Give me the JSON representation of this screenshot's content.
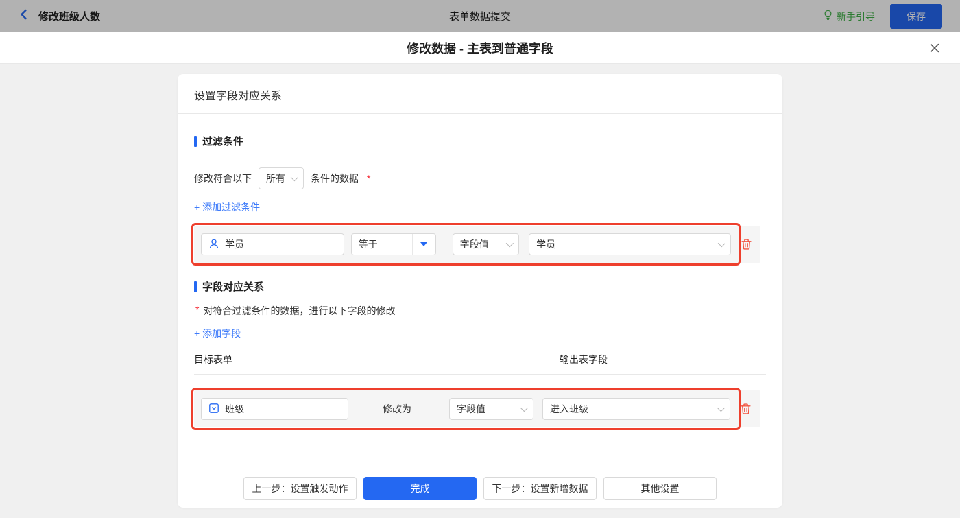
{
  "topbar": {
    "back_title": "修改班级人数",
    "center_title": "表单数据提交",
    "guide": "新手引导",
    "save": "保存"
  },
  "modal": {
    "title": "修改数据 - 主表到普通字段"
  },
  "panel": {
    "header": "设置字段对应关系",
    "filter": {
      "title": "过滤条件",
      "match_prefix": "修改符合以下",
      "match_value": "所有",
      "match_suffix": "条件的数据",
      "required": "*",
      "add_link": "+ 添加过滤条件",
      "row": {
        "field": "学员",
        "operator": "等于",
        "value_type": "字段值",
        "value": "学员"
      }
    },
    "mapping": {
      "title": "字段对应关系",
      "required": "*",
      "desc": "对符合过滤条件的数据，进行以下字段的修改",
      "add_link": "+ 添加字段",
      "col_target": "目标表单",
      "col_output": "输出表字段",
      "row": {
        "field": "班级",
        "action": "修改为",
        "value_type": "字段值",
        "value": "进入班级"
      }
    },
    "footer": {
      "prev": "上一步：设置触发动作",
      "done": "完成",
      "next": "下一步：设置新增数据",
      "other": "其他设置"
    }
  },
  "colors": {
    "primary_blue": "#2468f2",
    "link_blue": "#3e7bfa",
    "guide_green": "#40b047",
    "highlight_red": "#ee3f2d",
    "danger_red": "#f25643",
    "asterisk_red": "#f5222d",
    "row_gray": "#f5f5f5"
  }
}
